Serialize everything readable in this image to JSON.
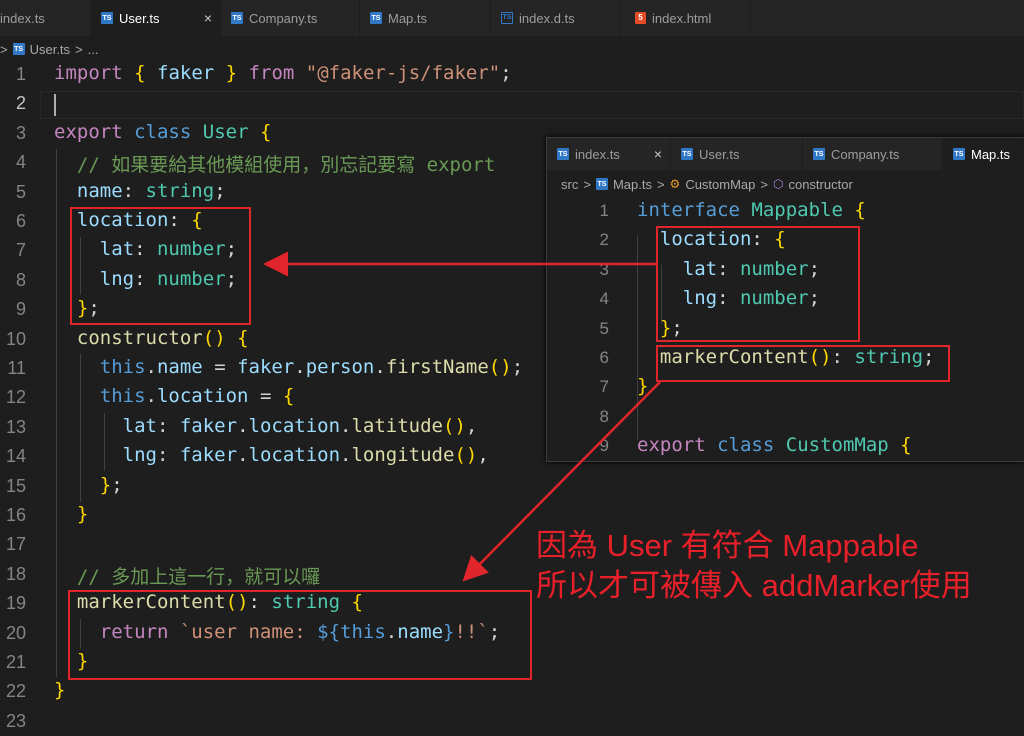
{
  "main_tabs": [
    {
      "label": "index.ts",
      "icon": "ts-icon"
    },
    {
      "label": "User.ts",
      "icon": "ts-icon",
      "active": true,
      "close": "×"
    },
    {
      "label": "Company.ts",
      "icon": "ts-icon"
    },
    {
      "label": "Map.ts",
      "icon": "ts-icon"
    },
    {
      "label": "index.d.ts",
      "icon": "ts-icon"
    },
    {
      "label": "index.html",
      "icon": "html-icon"
    }
  ],
  "breadcrumb": {
    "file": "User.ts",
    "more": "..."
  },
  "main_line_numbers": [
    "1",
    "2",
    "3",
    "4",
    "5",
    "6",
    "7",
    "8",
    "9",
    "10",
    "11",
    "12",
    "13",
    "14",
    "15",
    "16",
    "17",
    "18",
    "19",
    "20",
    "21",
    "22",
    "23"
  ],
  "main_code": [
    "import { faker } from \"@faker-js/faker\";",
    "",
    "export class User {",
    "  // 如果要給其他模組使用，別忘記要寫 export",
    "  name: string;",
    "  location: {",
    "    lat: number;",
    "    lng: number;",
    "  };",
    "  constructor() {",
    "    this.name = faker.person.firstName();",
    "    this.location = {",
    "      lat: faker.location.latitude(),",
    "      lng: faker.location.longitude(),",
    "    };",
    "  }",
    "",
    "  // 多加上這一行，就可以囉",
    "  markerContent(): string {",
    "    return `user name: ${this.name}!!`;",
    "  }",
    "}",
    ""
  ],
  "panel_tabs": [
    {
      "label": "index.ts",
      "close": "×"
    },
    {
      "label": "User.ts"
    },
    {
      "label": "Company.ts"
    },
    {
      "label": "Map.ts",
      "active": true
    }
  ],
  "panel_breadcrumb": {
    "src": "src",
    "file": "Map.ts",
    "class": "CustomMap",
    "member": "constructor"
  },
  "panel_line_numbers": [
    "1",
    "2",
    "3",
    "4",
    "5",
    "6",
    "7",
    "8",
    "9"
  ],
  "panel_code": [
    "interface Mappable {",
    "  location: {",
    "    lat: number;",
    "    lng: number;",
    "  };",
    "  markerContent(): string;",
    "}",
    "",
    "export class CustomMap {"
  ],
  "annotation": {
    "line1": "因為 User 有符合 Mappable",
    "line2": "所以才可被傳入 addMarker使用"
  },
  "colors": {
    "annotation": "#e8202a",
    "background": "#1e1e1e",
    "keyword": "#569cd6",
    "type": "#4ec9b0"
  }
}
